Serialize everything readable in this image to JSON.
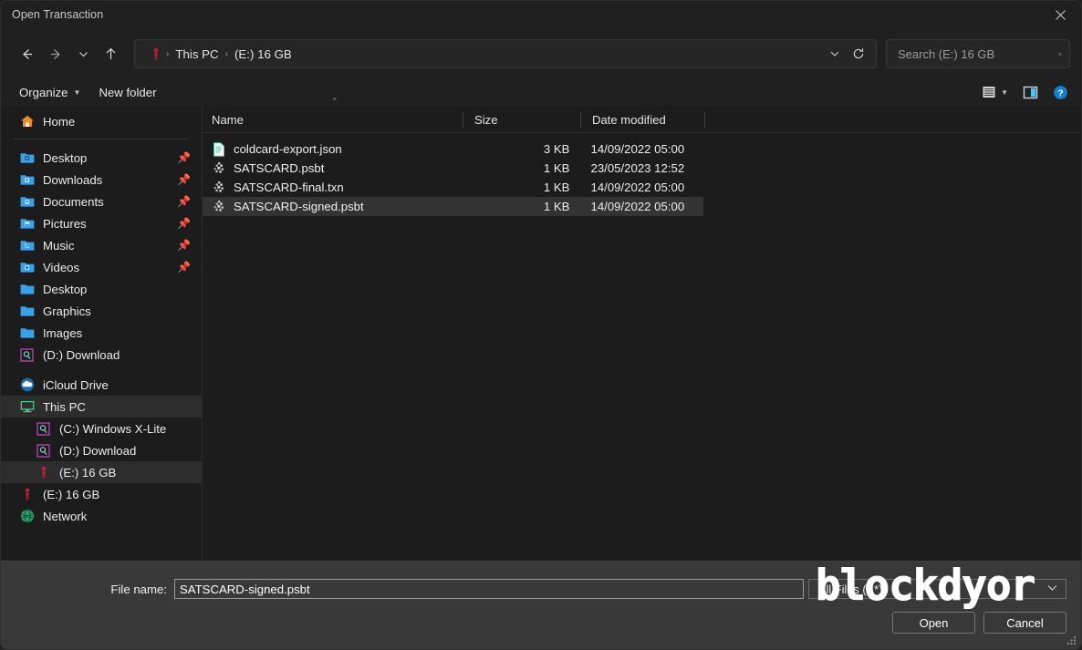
{
  "window": {
    "title": "Open Transaction",
    "close_label": "✕"
  },
  "nav": {
    "back_icon": "arrow-left-icon",
    "forward_icon": "arrow-right-icon",
    "recent_icon": "chevron-down-icon",
    "up_icon": "arrow-up-icon",
    "refresh_icon": "refresh-icon",
    "breadcrumb": [
      "This PC",
      "(E:) 16 GB"
    ],
    "separator": "›"
  },
  "search": {
    "placeholder": "Search (E:) 16 GB",
    "value": ""
  },
  "commandbar": {
    "organize_label": "Organize",
    "organize_caret": "▼",
    "new_folder_label": "New folder",
    "view_icon": "list-view-icon",
    "view_caret": "▼",
    "pane_icon": "preview-pane-icon",
    "help_icon": "help-icon"
  },
  "sidebar": {
    "home": {
      "label": "Home",
      "icon": "home-icon"
    },
    "quick_access": [
      {
        "label": "Desktop",
        "icon": "folder-desktop-icon",
        "pinned": true
      },
      {
        "label": "Downloads",
        "icon": "folder-downloads-icon",
        "pinned": true
      },
      {
        "label": "Documents",
        "icon": "folder-documents-icon",
        "pinned": true
      },
      {
        "label": "Pictures",
        "icon": "folder-pictures-icon",
        "pinned": true
      },
      {
        "label": "Music",
        "icon": "folder-music-icon",
        "pinned": true
      },
      {
        "label": "Videos",
        "icon": "folder-videos-icon",
        "pinned": true
      },
      {
        "label": "Desktop",
        "icon": "folder-icon",
        "pinned": false
      },
      {
        "label": "Graphics",
        "icon": "folder-icon",
        "pinned": false
      },
      {
        "label": "Images",
        "icon": "folder-icon",
        "pinned": false
      },
      {
        "label": "(D:) Download",
        "icon": "drive-icon",
        "pinned": false
      }
    ],
    "locations": [
      {
        "label": "iCloud Drive",
        "icon": "icloud-icon",
        "indent": 0,
        "selected": false
      },
      {
        "label": "This PC",
        "icon": "this-pc-icon",
        "indent": 0,
        "selected": true
      },
      {
        "label": "(C:) Windows X-Lite",
        "icon": "drive-icon",
        "indent": 1,
        "selected": false
      },
      {
        "label": "(D:) Download",
        "icon": "drive-icon",
        "indent": 1,
        "selected": false
      },
      {
        "label": "(E:) 16 GB",
        "icon": "usb-drive-icon",
        "indent": 1,
        "selected": true
      },
      {
        "label": "(E:) 16 GB",
        "icon": "usb-drive-icon",
        "indent": 0,
        "selected": false
      },
      {
        "label": "Network",
        "icon": "network-icon",
        "indent": 0,
        "selected": false
      }
    ]
  },
  "filelist": {
    "columns": [
      "Name",
      "Size",
      "Date modified"
    ],
    "sort_indicator": "⌃",
    "rows": [
      {
        "name": "coldcard-export.json",
        "size": "3 KB",
        "date": "14/09/2022 05:00",
        "icon": "json-file-icon",
        "selected": false
      },
      {
        "name": "SATSCARD.psbt",
        "size": "1 KB",
        "date": "23/05/2023 12:52",
        "icon": "psbt-file-icon",
        "selected": false
      },
      {
        "name": "SATSCARD-final.txn",
        "size": "1 KB",
        "date": "14/09/2022 05:00",
        "icon": "psbt-file-icon",
        "selected": false
      },
      {
        "name": "SATSCARD-signed.psbt",
        "size": "1 KB",
        "date": "14/09/2022 05:00",
        "icon": "psbt-file-icon",
        "selected": true
      }
    ]
  },
  "footer": {
    "filename_label": "File name:",
    "filename_value": "SATSCARD-signed.psbt",
    "filter_value": "All Files (*.*)",
    "filter_caret": "⌄",
    "open_label": "Open",
    "cancel_label": "Cancel"
  },
  "watermark": {
    "text": "blockdyor"
  },
  "colors": {
    "window_bg": "#1c1c1c",
    "chrome_bg": "#202020",
    "footer_bg": "#393939",
    "accent": "#4cc2ff",
    "folder_blue": "#3aa0e8",
    "drive_magenta": "#cc44cc",
    "usb_red": "#b22236",
    "selection": "#333333"
  }
}
